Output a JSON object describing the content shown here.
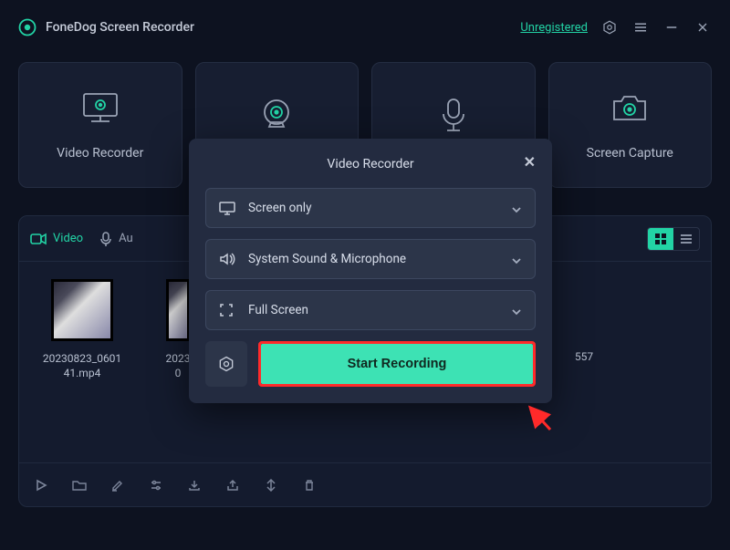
{
  "titlebar": {
    "app_title": "FoneDog Screen Recorder",
    "unregistered": "Unregistered"
  },
  "modes": [
    {
      "label": "Video Recorder"
    },
    {
      "label": ""
    },
    {
      "label": ""
    },
    {
      "label": "Screen Capture"
    }
  ],
  "tabs": {
    "video": "Video",
    "audio_partial": "Au"
  },
  "thumbs": {
    "t0": "20230823_060141.mp4",
    "t1_partial": "2023\n0",
    "t2_partial": "557"
  },
  "modal": {
    "title": "Video Recorder",
    "row1": "Screen only",
    "row2": "System Sound & Microphone",
    "row3": "Full Screen",
    "start": "Start Recording"
  }
}
